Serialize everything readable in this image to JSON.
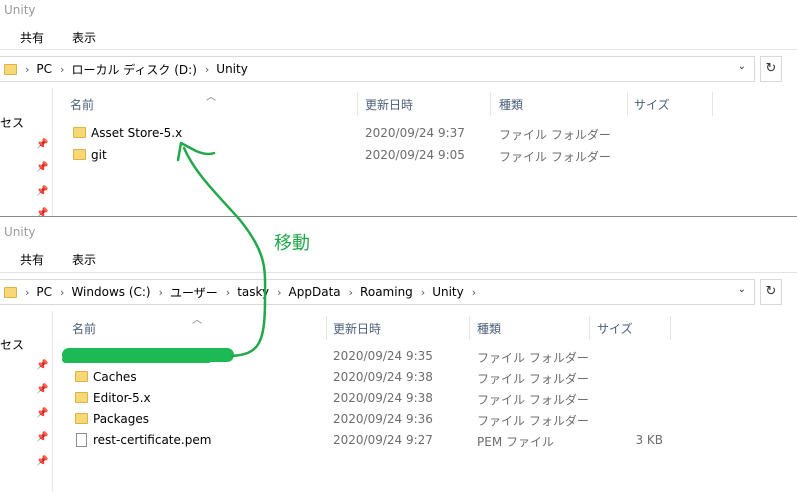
{
  "colors": {
    "annotation": "#22a84a",
    "folder": "#f8d775",
    "column_header": "#4c607a"
  },
  "window_top": {
    "title": "Unity",
    "ribbon": {
      "share": "共有",
      "view": "表示"
    },
    "path": [
      "PC",
      "ローカル ディスク (D:)",
      "Unity"
    ],
    "nav_label": "セス",
    "columns": {
      "name": "名前",
      "date": "更新日時",
      "type": "種類",
      "size": "サイズ"
    },
    "files": [
      {
        "name": "Asset Store-5.x",
        "date": "2020/09/24 9:37",
        "type": "ファイル フォルダー",
        "size": "",
        "icon": "folder-icon"
      },
      {
        "name": "git",
        "date": "2020/09/24 9:05",
        "type": "ファイル フォルダー",
        "size": "",
        "icon": "folder-icon"
      }
    ]
  },
  "window_bottom": {
    "title": "Unity",
    "ribbon": {
      "share": "共有",
      "view": "表示"
    },
    "path": [
      "PC",
      "Windows (C:)",
      "ユーザー",
      "tasky",
      "AppData",
      "Roaming",
      "Unity"
    ],
    "nav_label": "セス",
    "columns": {
      "name": "名前",
      "date": "更新日時",
      "type": "種類",
      "size": "サイズ"
    },
    "files": [
      {
        "name": "",
        "date": "2020/09/24 9:35",
        "type": "ファイル フォルダー",
        "size": "",
        "icon": "folder-icon",
        "redacted": true
      },
      {
        "name": "Caches",
        "date": "2020/09/24 9:38",
        "type": "ファイル フォルダー",
        "size": "",
        "icon": "folder-icon"
      },
      {
        "name": "Editor-5.x",
        "date": "2020/09/24 9:38",
        "type": "ファイル フォルダー",
        "size": "",
        "icon": "folder-icon"
      },
      {
        "name": "Packages",
        "date": "2020/09/24 9:36",
        "type": "ファイル フォルダー",
        "size": "",
        "icon": "folder-icon"
      },
      {
        "name": "rest-certificate.pem",
        "date": "2020/09/24 9:27",
        "type": "PEM ファイル",
        "size": "3 KB",
        "icon": "file-icon"
      }
    ]
  },
  "annotation": {
    "label": "移動"
  }
}
